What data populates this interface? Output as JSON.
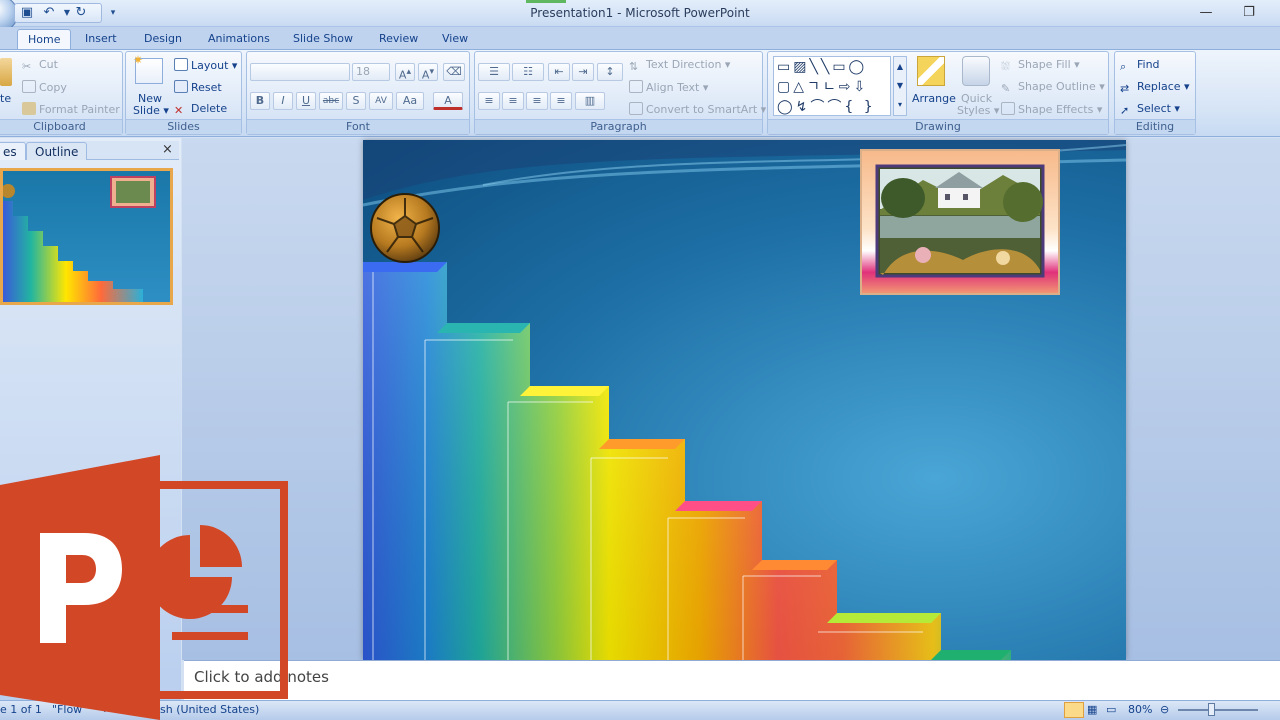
{
  "window": {
    "title": "Presentation1 - Microsoft PowerPoint"
  },
  "tabs": [
    "Home",
    "Insert",
    "Design",
    "Animations",
    "Slide Show",
    "Review",
    "View"
  ],
  "active_tab": "Home",
  "ribbon": {
    "clipboard": {
      "label": "Clipboard",
      "paste": "te",
      "cut": "Cut",
      "copy": "Copy",
      "format_painter": "Format Painter"
    },
    "slides": {
      "label": "Slides",
      "new_slide": "New",
      "new_slide_2": "Slide",
      "layout": "Layout",
      "reset": "Reset",
      "delete": "Delete"
    },
    "font": {
      "label": "Font",
      "font_name": "",
      "font_size": "18"
    },
    "paragraph": {
      "label": "Paragraph",
      "text_direction": "Text Direction",
      "align_text": "Align Text",
      "convert_smartart": "Convert to SmartArt"
    },
    "drawing": {
      "label": "Drawing",
      "arrange": "Arrange",
      "quick": "Quick",
      "styles": "Styles",
      "shape_fill": "Shape Fill",
      "shape_outline": "Shape Outline",
      "shape_effects": "Shape Effects"
    },
    "editing": {
      "label": "Editing",
      "find": "Find",
      "replace": "Replace",
      "select": "Select"
    }
  },
  "left_pane": {
    "tab_slides": "es",
    "tab_outline": "Outline",
    "close": "×"
  },
  "notes": {
    "placeholder": "Click to add notes"
  },
  "status_bar": {
    "slide": "e 1 of 1",
    "theme": "\"Flow\"",
    "language": "English (United States)",
    "zoom": "80%"
  },
  "colors": {
    "accent": "#d24726",
    "slide_bg": "#1d6fa5"
  }
}
